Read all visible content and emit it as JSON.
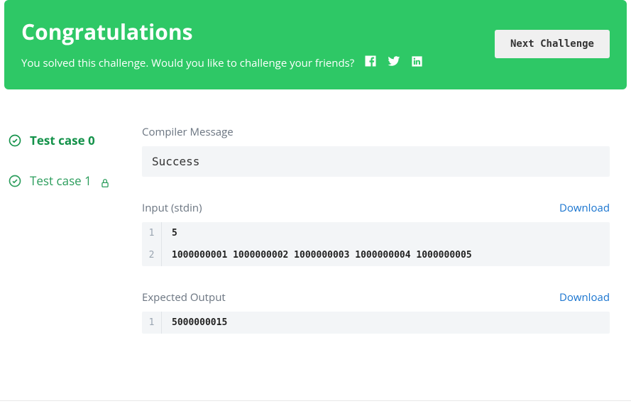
{
  "banner": {
    "title": "Congratulations",
    "subtitle": "You solved this challenge. Would you like to challenge your friends?",
    "next_button": "Next Challenge"
  },
  "sidebar": {
    "items": [
      {
        "label": "Test case 0",
        "locked": false,
        "active": true
      },
      {
        "label": "Test case 1",
        "locked": true,
        "active": false
      }
    ]
  },
  "compiler": {
    "title": "Compiler Message",
    "message": "Success"
  },
  "input": {
    "title": "Input (stdin)",
    "download_label": "Download",
    "lines": [
      "5",
      "1000000001 1000000002 1000000003 1000000004 1000000005"
    ]
  },
  "expected": {
    "title": "Expected Output",
    "download_label": "Download",
    "lines": [
      "5000000015"
    ]
  }
}
